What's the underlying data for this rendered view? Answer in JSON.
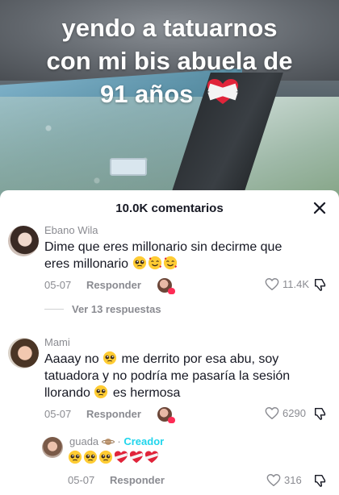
{
  "video": {
    "caption_line1": "yendo a tatuarnos",
    "caption_line2": "con mi bis abuela de",
    "caption_line3": "91 años"
  },
  "comments_sheet": {
    "title": "10.0K comentarios",
    "close_icon": "close-icon"
  },
  "comments": [
    {
      "username": "Ebano Wila",
      "text_line1": "Dime que eres millonario sin decirme que",
      "text_line2": "eres millonario",
      "text_emojis": [
        "pleading-face",
        "smiling-face-with-hearts",
        "smiling-face-with-hearts"
      ],
      "date": "05-07",
      "reply_label": "Responder",
      "likes": "11.4K",
      "view_replies": "Ver 13 respuestas"
    },
    {
      "username": "Mami",
      "text_line1a": "Aaaay no",
      "text_line1b": "me derrito por esa abu, soy",
      "text_line2": "tatuadora y no podría me pasaría la sesión",
      "text_line3a": "llorando",
      "text_line3b": "es hermosa",
      "date": "05-07",
      "reply_label": "Responder",
      "likes": "6290"
    }
  ],
  "reply": {
    "username": "guada",
    "username_emoji": "ringed-planet",
    "creator_label": "Creador",
    "text_emojis": [
      "pleading-face",
      "pleading-face",
      "pleading-face",
      "heart-with-bandage",
      "heart-with-bandage",
      "heart-with-bandage"
    ],
    "date": "05-07",
    "reply_label": "Responder",
    "likes": "316"
  },
  "colors": {
    "text": "#161823",
    "muted": "#8a8b91",
    "creator": "#20d5ec",
    "like_red": "#fe2c55"
  }
}
